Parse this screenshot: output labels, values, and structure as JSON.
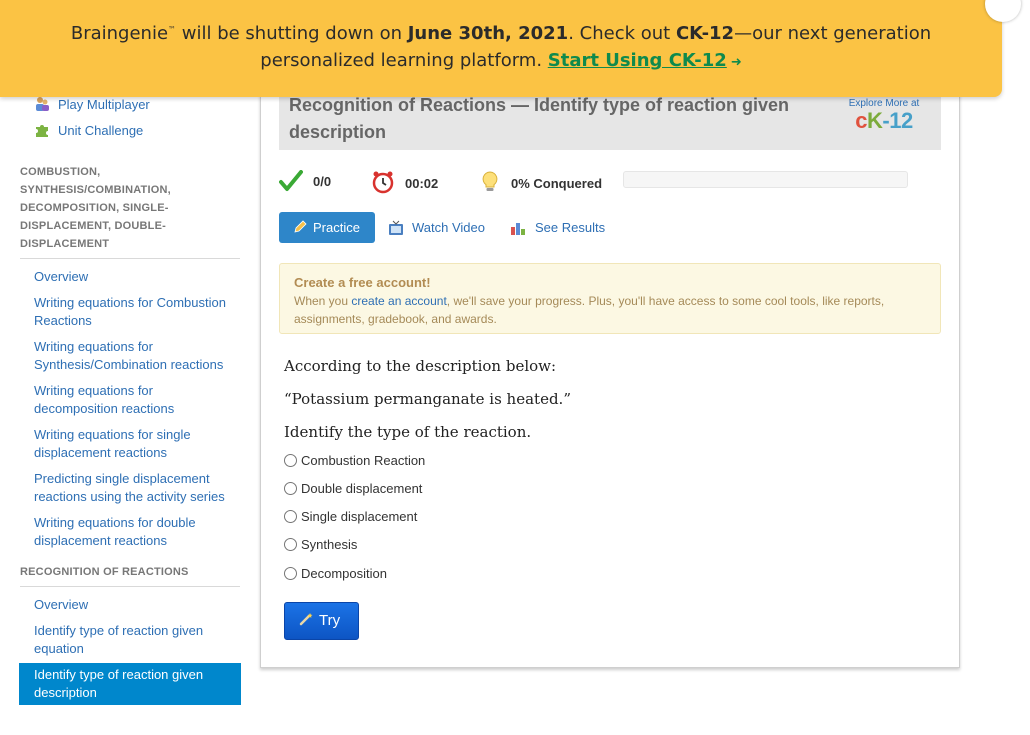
{
  "banner": {
    "brand": "Braingenie",
    "tm": "™",
    "text1": " will be shutting down on ",
    "date": "June 30th, 2021",
    "text2": ". Check out ",
    "ck12": "CK-12",
    "text3": "—our next generation",
    "line2": "personalized learning platform. ",
    "cta": "Start Using CK-12",
    "arrow": "➜"
  },
  "sidebar": {
    "top_items": [
      {
        "label": "Play Multiplayer",
        "icon": "multiplayer-icon"
      },
      {
        "label": "Unit Challenge",
        "icon": "puzzle-icon"
      }
    ],
    "section1_title": "COMBUSTION, SYNTHESIS/COMBINATION, DECOMPOSITION, SINGLE-DISPLACEMENT, DOUBLE-DISPLACEMENT",
    "section1_items": [
      "Overview",
      "Writing equations for Combustion Reactions",
      "Writing equations for Synthesis/Combination reactions",
      "Writing equations for decomposition reactions",
      "Writing equations for single displacement reactions",
      "Predicting single displacement reactions using the activity series",
      "Writing equations for double displacement reactions"
    ],
    "section2_title": "RECOGNITION OF REACTIONS",
    "section2_items": [
      "Overview",
      "Identify type of reaction given equation",
      "Identify type of reaction given description"
    ]
  },
  "main": {
    "title": "Recognition of Reactions — Identify type of reaction given description",
    "explore_label": "Explore More at",
    "logo": {
      "c": "c",
      "k": "K",
      "n": "-12"
    },
    "stats": {
      "score": "0/0",
      "time": "00:02",
      "conquered": "0% Conquered",
      "progress_fraction": 0
    },
    "tabs": {
      "practice": "Practice",
      "video": "Watch Video",
      "results": "See Results"
    },
    "account": {
      "title": "Create a free account!",
      "text_before": "When you ",
      "link": "create an account",
      "text_after": ", we'll save your progress. Plus, you'll have access to some cool tools, like reports, assignments, gradebook, and awards."
    },
    "question": {
      "line1": "According to the description below:",
      "line2": "“Potassium permanganate is heated.”",
      "line3": "Identify the type of the reaction."
    },
    "options": [
      "Combustion Reaction",
      "Double displacement",
      "Single displacement",
      "Synthesis",
      "Decomposition"
    ],
    "try_label": "Try"
  },
  "colors": {
    "banner": "#fbc344",
    "link_green": "#0f8a4d",
    "link_blue": "#2e6fb4",
    "active_nav": "#0087cc",
    "practice_tab": "#2e86c9",
    "try_button": "#1b73e6"
  }
}
